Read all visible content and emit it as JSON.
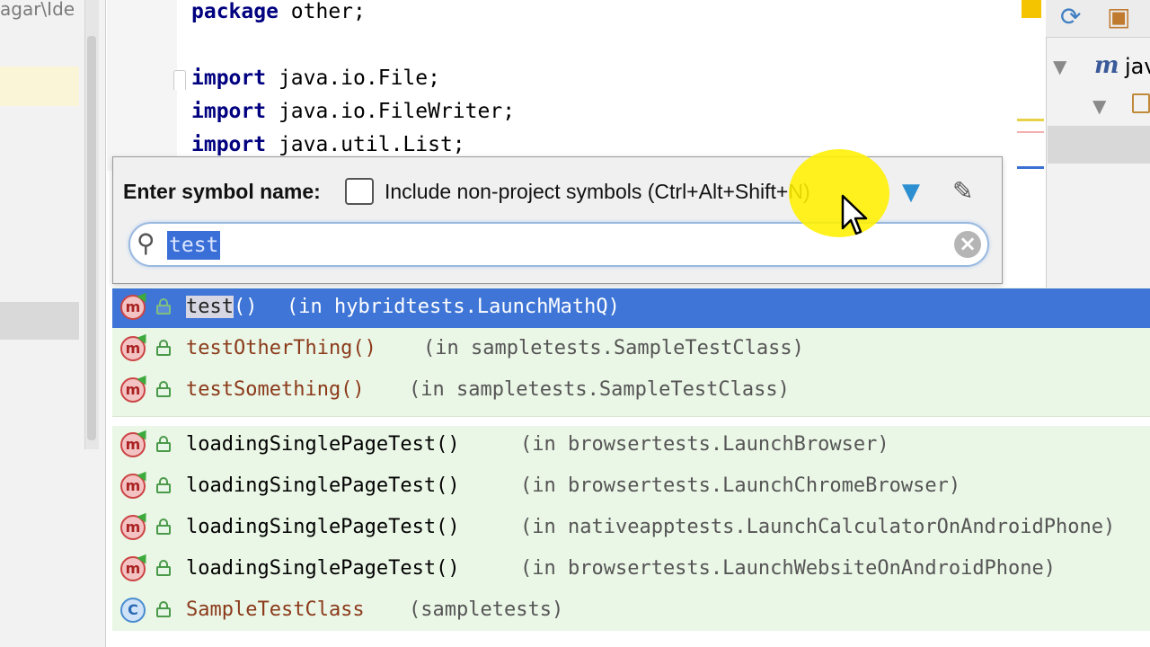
{
  "project": {
    "path_fragment": "agar\\Ide"
  },
  "editor": {
    "lines": [
      {
        "keyword": "package",
        "rest": " other;"
      },
      {
        "keyword": "import",
        "rest": " java.io.File;"
      },
      {
        "keyword": "import",
        "rest": " java.io.FileWriter;"
      },
      {
        "keyword": "import",
        "rest": " java.util.List;"
      }
    ]
  },
  "right_panel": {
    "node_label": "jav"
  },
  "popup": {
    "label": "Enter symbol name:",
    "checkbox_label": "Include non-project symbols (Ctrl+Alt+Shift+N)",
    "checkbox_checked": false,
    "search_value": "test"
  },
  "results": [
    {
      "icon": "method-icon",
      "name_match": "test",
      "name_rest": "()",
      "location": "(in hybridtests.LaunchMathQ)",
      "selected": true
    },
    {
      "icon": "method-icon",
      "name_match": "",
      "name_rest": "testOtherThing()",
      "location": "(in sampletests.SampleTestClass)",
      "selected": false
    },
    {
      "icon": "method-icon",
      "name_match": "",
      "name_rest": "testSomething()",
      "location": "(in sampletests.SampleTestClass)",
      "selected": false
    },
    {
      "icon": "method-icon",
      "name_match": "",
      "name_rest": "loadingSinglePageTest()",
      "location": "(in browsertests.LaunchBrowser)",
      "selected": false
    },
    {
      "icon": "method-icon",
      "name_match": "",
      "name_rest": "loadingSinglePageTest()",
      "location": "(in browsertests.LaunchChromeBrowser)",
      "selected": false
    },
    {
      "icon": "method-icon",
      "name_match": "",
      "name_rest": "loadingSinglePageTest()",
      "location": "(in nativeapptests.LaunchCalculatorOnAndroidPhone)",
      "selected": false
    },
    {
      "icon": "method-icon",
      "name_match": "",
      "name_rest": "loadingSinglePageTest()",
      "location": "(in browsertests.LaunchWebsiteOnAndroidPhone)",
      "selected": false
    },
    {
      "icon": "class-icon",
      "name_match": "",
      "name_rest": "SampleTestClass",
      "location": "(sampletests)",
      "selected": false
    }
  ],
  "colors": {
    "selection": "#3e75d6",
    "match_bg": "#eaf6e6",
    "accent": "#2c8fd1"
  }
}
